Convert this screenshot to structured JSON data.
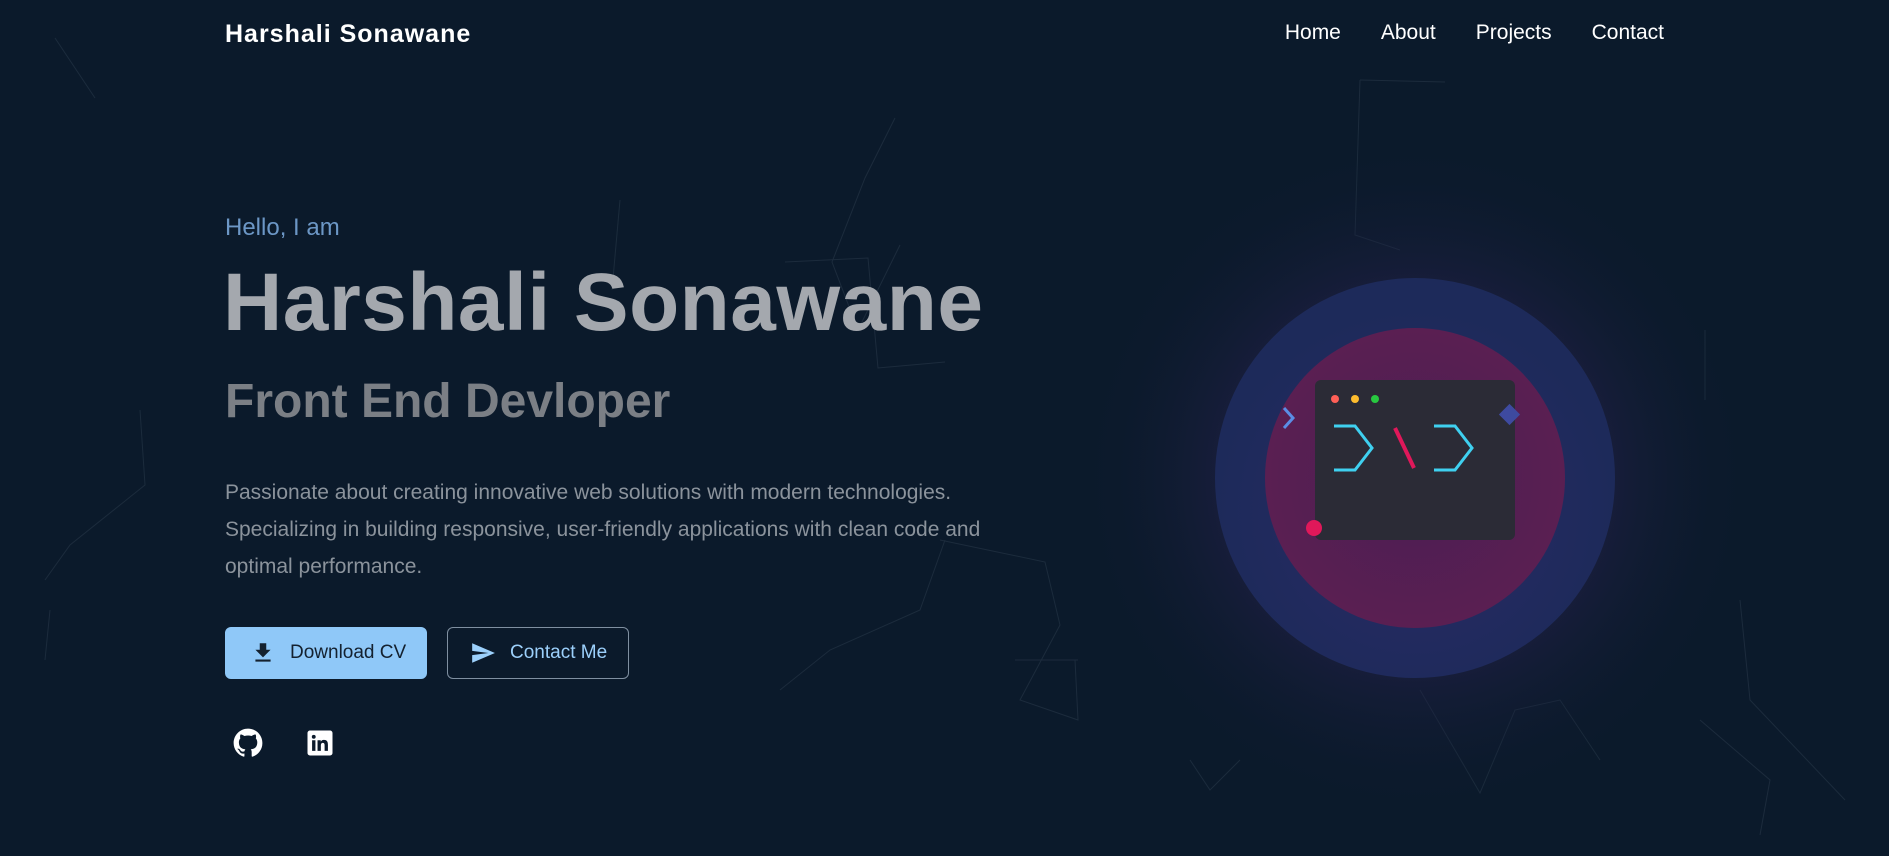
{
  "nav": {
    "brand": "Harshali Sonawane",
    "links": [
      "Home",
      "About",
      "Projects",
      "Contact"
    ]
  },
  "hero": {
    "greeting": "Hello, I am",
    "name": "Harshali Sonawane",
    "role": "Front End Devloper",
    "description": "Passionate about creating innovative web solutions with modern technologies. Specializing in building responsive, user-friendly applications with clean code and optimal performance.",
    "buttons": {
      "primary": {
        "label": "Download CV",
        "icon": "download-icon"
      },
      "secondary": {
        "label": "Contact Me",
        "icon": "send-icon"
      }
    },
    "social": [
      {
        "name": "github-icon"
      },
      {
        "name": "linkedin-icon"
      }
    ]
  },
  "colors": {
    "background": "#0b1a2b",
    "accent": "#8fc8f8",
    "greeting": "#6c97c6",
    "code_chevron": "#3fd0f0",
    "code_slash": "#e0185a",
    "pink_glow": "#7a1f55",
    "blue_glow": "#1f2f6b"
  }
}
